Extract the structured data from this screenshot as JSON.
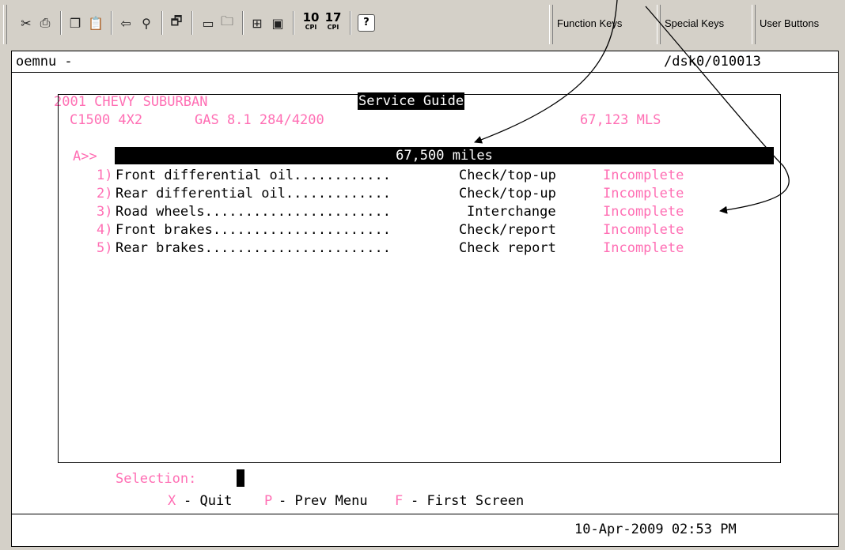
{
  "toolbar": {
    "icons": [
      "scissors-icon",
      "print-icon",
      "copy-icon",
      "paste-icon",
      "back-icon",
      "find-icon",
      "properties-icon",
      "new-window-icon",
      "open-icon",
      "fullscreen-icon",
      "window-icon"
    ],
    "cpi10": {
      "number": "10",
      "unit": "CPI"
    },
    "cpi17": {
      "number": "17",
      "unit": "CPI"
    },
    "help": "?",
    "function_keys": "Function Keys",
    "special_keys": "Special Keys",
    "user_buttons": "User Buttons"
  },
  "terminal": {
    "program": "oemnu -",
    "path": "/dsk0/010013",
    "vehicle": "2001 CHEVY SUBURBAN",
    "title": "Service Guide",
    "model": "C1500 4X2",
    "engine": "GAS 8.1 284/4200",
    "mileage": "67,123 MLS",
    "section_marker": "A>>",
    "section_title": "67,500 miles",
    "items": [
      {
        "num": "1)",
        "desc": "Front differential oil............",
        "action": "Check/top-up",
        "status": "Incomplete"
      },
      {
        "num": "2)",
        "desc": "Rear differential oil.............",
        "action": "Check/top-up",
        "status": "Incomplete"
      },
      {
        "num": "3)",
        "desc": "Road wheels.......................",
        "action": "Interchange",
        "status": "Incomplete"
      },
      {
        "num": "4)",
        "desc": "Front brakes......................",
        "action": "Check/report",
        "status": "Incomplete"
      },
      {
        "num": "5)",
        "desc": "Rear brakes.......................",
        "action": "Check report",
        "status": "Incomplete"
      }
    ],
    "selection_label": "Selection:",
    "keys": [
      {
        "key": "X",
        "label": "- Quit"
      },
      {
        "key": "P",
        "label": "- Prev Menu"
      },
      {
        "key": "F",
        "label": "- First Screen"
      }
    ],
    "datetime": "10-Apr-2009 02:53 PM"
  },
  "colors": {
    "highlight": "#ff6fb4",
    "toolbar": "#d4d0c8"
  }
}
